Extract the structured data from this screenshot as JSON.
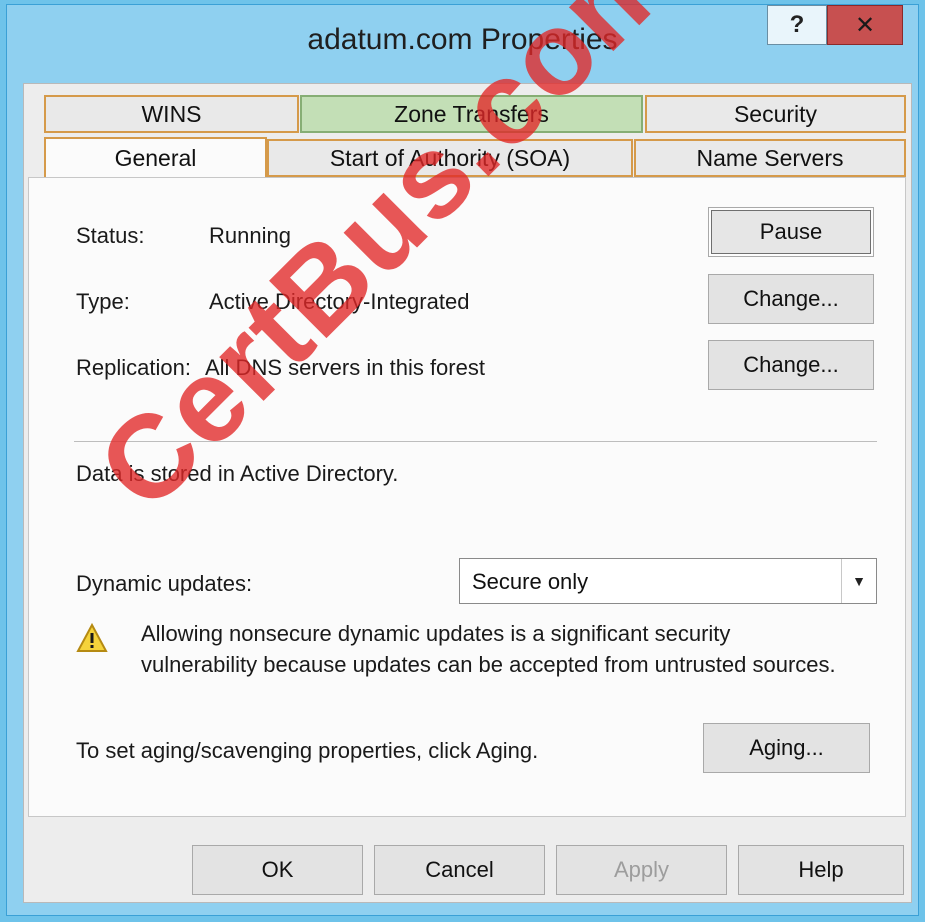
{
  "window": {
    "title": "adatum.com Properties",
    "help_button": "?",
    "close_button": "✕"
  },
  "tabs_row1": [
    {
      "label": "WINS"
    },
    {
      "label": "Zone Transfers"
    },
    {
      "label": "Security"
    }
  ],
  "tabs_row2": [
    {
      "label": "General",
      "selected": true
    },
    {
      "label": "Start of Authority (SOA)"
    },
    {
      "label": "Name Servers"
    }
  ],
  "general": {
    "status_label": "Status:",
    "status_value": "Running",
    "pause_button": "Pause",
    "type_label": "Type:",
    "type_value": "Active Directory-Integrated",
    "type_change_button": "Change...",
    "replication_label": "Replication:",
    "replication_value": "All DNS servers in this forest",
    "replication_change_button": "Change...",
    "storage_text": "Data is stored in Active Directory.",
    "dynamic_updates_label": "Dynamic updates:",
    "dynamic_updates_value": "Secure only",
    "warning_text": "Allowing nonsecure dynamic updates is a significant security vulnerability because updates can be accepted from untrusted sources.",
    "aging_text": "To set aging/scavenging properties, click Aging.",
    "aging_button": "Aging..."
  },
  "footer": {
    "ok_button": "OK",
    "cancel_button": "Cancel",
    "apply_button": "Apply",
    "help_button": "Help"
  },
  "watermark": "CertBus.com",
  "colors": {
    "title_bar": "#8fd0f0",
    "close_button": "#c75050",
    "selected_tab_border": "#d59a4a",
    "zone_transfers_tab": "#c3dfb6",
    "watermark": "#e12828"
  }
}
